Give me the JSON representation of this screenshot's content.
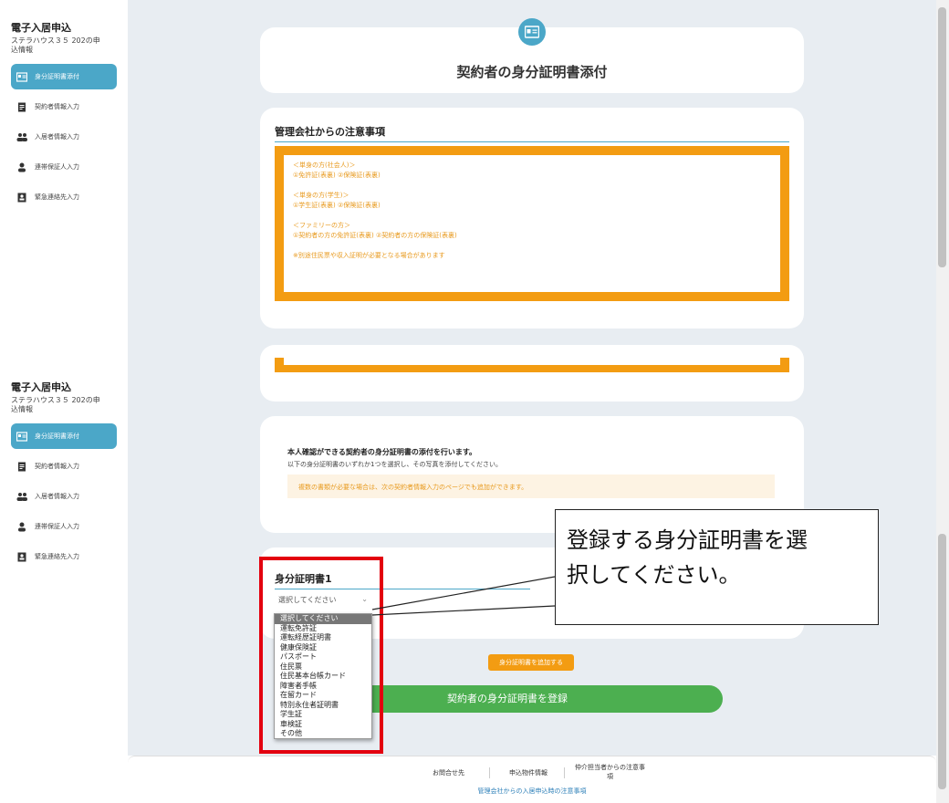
{
  "sidebar": {
    "title": "電子入居申込",
    "subtitle_line1": "ステラハウス３５ 202の申",
    "subtitle_line2": "込情報",
    "items": [
      {
        "label": "身分証明書添付",
        "icon": "id-card-icon",
        "active": true
      },
      {
        "label": "契約者情報入力",
        "icon": "document-icon",
        "active": false
      },
      {
        "label": "入居者情報入力",
        "icon": "users-icon",
        "active": false
      },
      {
        "label": "連帯保証人入力",
        "icon": "user-icon",
        "active": false
      },
      {
        "label": "緊急連絡先入力",
        "icon": "contact-card-icon",
        "active": false
      }
    ]
  },
  "header": {
    "title": "契約者の身分証明書添付",
    "icon": "id-card-icon"
  },
  "notice": {
    "section_title": "管理会社からの注意事項",
    "lines": [
      "＜単身の方(社会人)＞",
      "①免許証(表裏) ②保険証(表裏)",
      "",
      "＜単身の方(学生)＞",
      "①学生証(表裏) ②保険証(表裏)",
      "",
      "＜ファミリーの方＞",
      "①契約者の方の免許証(表裏) ②契約者の方の保険証(表裏)",
      "",
      "※別途住民票や収入証明が必要となる場合があります"
    ]
  },
  "instructions": {
    "bold": "本人確認ができる契約者の身分証明書の添付を行います。",
    "text": "以下の身分証明書のいずれか1つを選択し、その写真を添付してください。",
    "info": "複数の書類が必要な場合は、次の契約者情報入力のページでも追加ができます。"
  },
  "document": {
    "section_title": "身分証明書1",
    "select_value": "選択してください",
    "options": [
      "選択してください",
      "運転免許証",
      "運転経歴証明書",
      "健康保険証",
      "パスポート",
      "住民票",
      "住民基本台帳カード",
      "障害者手帳",
      "在留カード",
      "特別永住者証明書",
      "学生証",
      "車検証",
      "その他"
    ]
  },
  "buttons": {
    "add": "身分証明書を追加する",
    "submit": "契約者の身分証明書を登録"
  },
  "callout": {
    "line1": "登録する身分証明書を選",
    "line2": "択してください。"
  },
  "footer": {
    "contact": "お問合せ先",
    "property": "申込物件情報",
    "agent_note_line1": "仲介担当者からの注意事",
    "agent_note_line2": "項",
    "management_note": "管理会社からの入居申込時の注意事項"
  },
  "colors": {
    "accent": "#4ba7c8",
    "orange": "#f39c12",
    "green": "#4caf50",
    "highlight_red": "#e3000f"
  }
}
